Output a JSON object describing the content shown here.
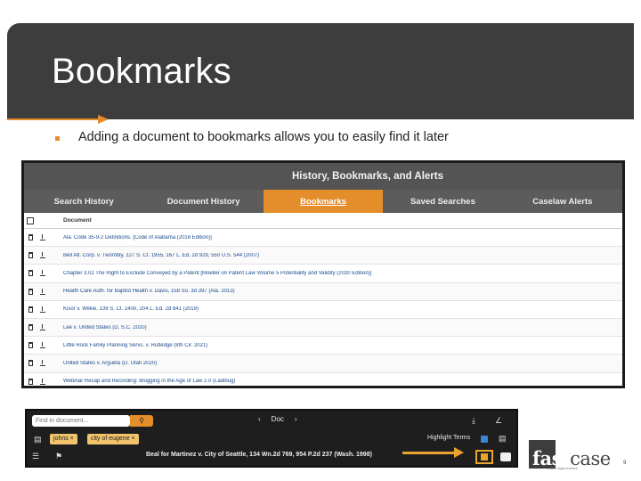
{
  "slide": {
    "title": "Bookmarks",
    "bullet": "Adding a document to bookmarks allows you to easily find it later",
    "page_number": "9"
  },
  "history_panel": {
    "header": "History, Bookmarks, and Alerts",
    "tabs": [
      "Search History",
      "Document History",
      "Bookmarks",
      "Saved Searches",
      "Caselaw Alerts"
    ],
    "active_tab": "Bookmarks",
    "column_header": "Document",
    "rows": [
      "Ala. Code 35-9-2 Definitions. [Code of Alabama (2018 Edition)]",
      "Bell Atl. Corp. v. Twombly, 127 S. Ct. 1955, 167 L. Ed. 2d 929, 550 U.S. 544 (2007)",
      "Chapter 3.02 The Right to Exclude Conveyed by a Patent [Moeller on Patent Law Volume 5 Potentiality and Validity (2020 Edition)]",
      "Health Care Auth. for Baptist Health v. Davis, 158 So. 3d 397 (Ala. 2013)",
      "Kisor v. Wilkie, 139 S. Ct. 2400, 204 L. Ed. 2d 841 (2019)",
      "Lee v. United States (D. S.C. 2020)",
      "Little Rock Family Planning Servs. v. Rutledge (8th Cir. 2021)",
      "United States v. Argueta (D. Utah 2020)",
      "Webinar Recap and Recording: Blogging in the Age of Law 2.0 (Ladibug)"
    ]
  },
  "toolbar": {
    "find_placeholder": "Find in document...",
    "doc_label": "Doc",
    "prev": "‹",
    "next": "›",
    "tags": [
      "johns ×",
      "city of eugene ×"
    ],
    "highlight_label": "Highlight Terms",
    "citation": "Beal for Martinez v. City of Seattle, 134 Wn.2d 769, 954 P.2d 237 (Wash. 1998)"
  },
  "logo": {
    "text_dark": "fast",
    "text_light": "case",
    "tagline": "smarter legal research"
  }
}
